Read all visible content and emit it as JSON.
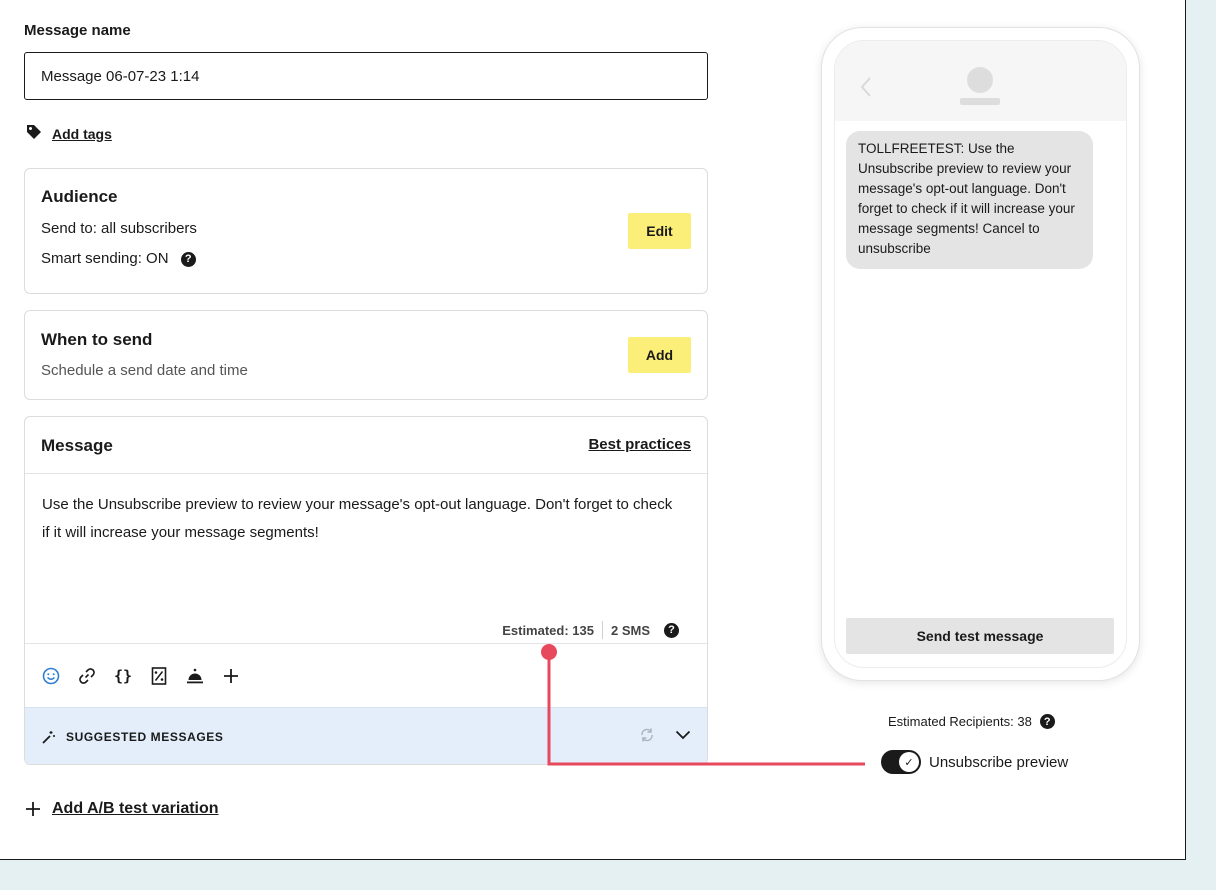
{
  "form": {
    "message_name_label": "Message name",
    "message_name_value": "Message 06-07-23 1:14",
    "add_tags": "Add tags"
  },
  "audience": {
    "title": "Audience",
    "send_to": "Send to: all subscribers",
    "smart_sending": "Smart sending: ON",
    "help": "?",
    "button": "Edit"
  },
  "when": {
    "title": "When to send",
    "subtitle": "Schedule a send date and time",
    "button": "Add"
  },
  "message": {
    "title": "Message",
    "best_practices": "Best practices",
    "body": "Use the Unsubscribe preview to review your message's opt-out language. Don't forget to check if it will increase your message segments!",
    "estimated": "Estimated: 135",
    "sms_count": "2 SMS",
    "help": "?",
    "toolbar_icons": [
      "emoji-icon",
      "link-icon",
      "braces-icon",
      "coupon-icon",
      "bell-icon",
      "plus-icon"
    ],
    "suggested_label": "SUGGESTED MESSAGES"
  },
  "ab_test": {
    "label": "Add A/B test variation"
  },
  "preview": {
    "bubble": "TOLLFREETEST: Use the Unsubscribe preview to review your message's opt-out language. Don't forget to check if it will increase your message segments! Cancel to unsubscribe",
    "send_test": "Send test message",
    "estimated_recipients": "Estimated Recipients: 38",
    "help": "?",
    "toggle_label": "Unsubscribe preview",
    "toggle_on": true
  },
  "colors": {
    "accent_yellow": "#fbef7a",
    "callout_red": "#e8485c",
    "suggest_bg": "#e3eefa",
    "emoji_blue": "#2f7fd6"
  }
}
